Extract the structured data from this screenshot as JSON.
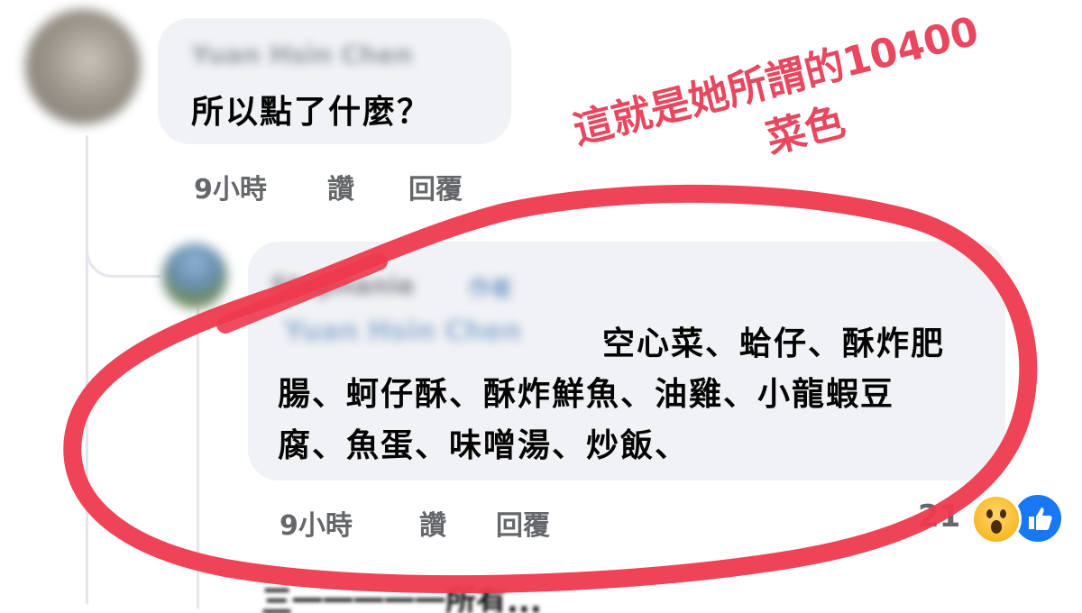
{
  "comments": [
    {
      "author": "Yuan Hsin Chen",
      "text": "所以點了什麼？",
      "time": "9小時",
      "like_label": "讚",
      "reply_label": "回覆"
    },
    {
      "author": "Stephanie",
      "author_tag": "作者",
      "mention": "Yuan Hsin Chen",
      "text_lines": [
        "空心菜、蛤仔、酥炸肥",
        "腸、蚵仔酥、酥炸鮮魚、油雞、小龍蝦豆",
        "腐、魚蛋、味噌湯、炒飯、"
      ],
      "time": "9小時",
      "like_label": "讚",
      "reply_label": "回覆",
      "reaction_count": "21",
      "reactions": [
        "wow-icon",
        "like-icon"
      ]
    }
  ],
  "annotation": {
    "line1": "這就是她所謂的10400",
    "line2": "菜色",
    "color": "#e8475f"
  },
  "partial_bottom_text": "三一一一一一所有......"
}
